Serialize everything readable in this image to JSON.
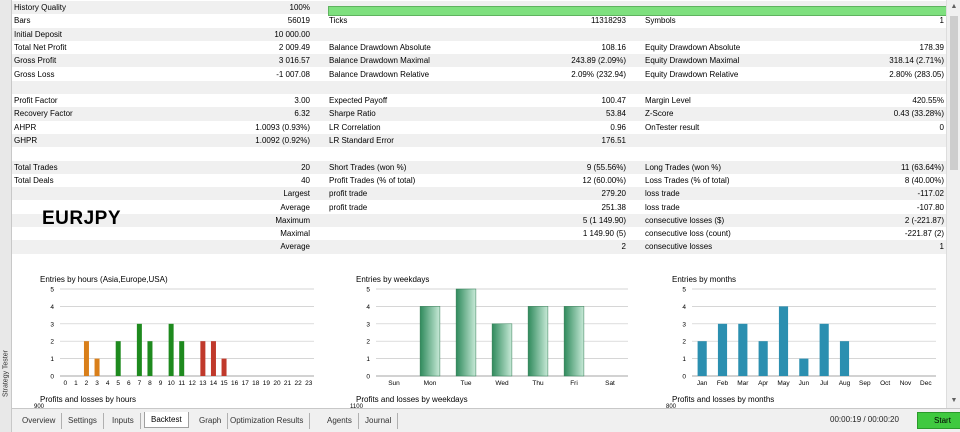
{
  "sidebar": {
    "label": "Strategy Tester"
  },
  "symbol": "EURJPY",
  "rows": [
    {
      "alt": true,
      "c": [
        [
          "History Quality",
          "100%"
        ],
        null,
        null
      ]
    },
    {
      "alt": false,
      "c": [
        [
          "Bars",
          "56019"
        ],
        [
          "Ticks",
          "11318293"
        ],
        [
          "Symbols",
          "1"
        ]
      ]
    },
    {
      "alt": true,
      "c": [
        [
          "Initial Deposit",
          "10 000.00"
        ],
        null,
        null
      ]
    },
    {
      "alt": false,
      "c": [
        [
          "Total Net Profit",
          "2 009.49"
        ],
        [
          "Balance Drawdown Absolute",
          "108.16"
        ],
        [
          "Equity Drawdown Absolute",
          "178.39"
        ]
      ]
    },
    {
      "alt": true,
      "c": [
        [
          "Gross Profit",
          "3 016.57"
        ],
        [
          "Balance Drawdown Maximal",
          "243.89 (2.09%)"
        ],
        [
          "Equity Drawdown Maximal",
          "318.14 (2.71%)"
        ]
      ]
    },
    {
      "alt": false,
      "c": [
        [
          "Gross Loss",
          "-1 007.08"
        ],
        [
          "Balance Drawdown Relative",
          "2.09% (232.94)"
        ],
        [
          "Equity Drawdown Relative",
          "2.80% (283.05)"
        ]
      ]
    },
    {
      "alt": true,
      "c": [
        null,
        null,
        null
      ]
    },
    {
      "alt": false,
      "c": [
        [
          "Profit Factor",
          "3.00"
        ],
        [
          "Expected Payoff",
          "100.47"
        ],
        [
          "Margin Level",
          "420.55%"
        ]
      ]
    },
    {
      "alt": true,
      "c": [
        [
          "Recovery Factor",
          "6.32"
        ],
        [
          "Sharpe Ratio",
          "53.84"
        ],
        [
          "Z-Score",
          "0.43 (33.28%)"
        ]
      ]
    },
    {
      "alt": false,
      "c": [
        [
          "AHPR",
          "1.0093 (0.93%)"
        ],
        [
          "LR Correlation",
          "0.96"
        ],
        [
          "OnTester result",
          "0"
        ]
      ]
    },
    {
      "alt": true,
      "c": [
        [
          "GHPR",
          "1.0092 (0.92%)"
        ],
        [
          "LR Standard Error",
          "176.51"
        ],
        null
      ]
    },
    {
      "alt": false,
      "c": [
        null,
        null,
        null
      ]
    },
    {
      "alt": true,
      "c": [
        [
          "Total Trades",
          "20"
        ],
        [
          "Short Trades (won %)",
          "9 (55.56%)"
        ],
        [
          "Long Trades (won %)",
          "11 (63.64%)"
        ]
      ]
    },
    {
      "alt": false,
      "c": [
        [
          "Total Deals",
          "40"
        ],
        [
          "Profit Trades (% of total)",
          "12 (60.00%)"
        ],
        [
          "Loss Trades (% of total)",
          "8 (40.00%)"
        ]
      ]
    },
    {
      "alt": true,
      "c": [
        [
          "Largest",
          "",
          "r"
        ],
        [
          "profit trade",
          "279.20"
        ],
        [
          "loss trade",
          "-117.02"
        ]
      ]
    },
    {
      "alt": false,
      "c": [
        [
          "Average",
          "",
          "r"
        ],
        [
          "profit trade",
          "251.38"
        ],
        [
          "loss trade",
          "-107.80"
        ]
      ]
    },
    {
      "alt": true,
      "c": [
        [
          "Maximum",
          "",
          "r"
        ],
        [
          "",
          "5 (1 149.90)"
        ],
        [
          "consecutive losses ($)",
          "2 (-221.87)"
        ]
      ]
    },
    {
      "alt": false,
      "c": [
        [
          "Maximal",
          "",
          "r"
        ],
        [
          "",
          "1 149.90 (5)"
        ],
        [
          "consecutive loss (count)",
          "-221.87 (2)"
        ]
      ]
    },
    {
      "alt": true,
      "c": [
        [
          "Average",
          "",
          "r"
        ],
        [
          "",
          "2"
        ],
        [
          "consecutive losses",
          "1"
        ]
      ]
    }
  ],
  "charts": [
    {
      "type": "bar",
      "title": "Entries by hours (Asia,Europe,USA)",
      "categories": [
        "0",
        "1",
        "2",
        "3",
        "4",
        "5",
        "6",
        "7",
        "8",
        "9",
        "10",
        "11",
        "12",
        "13",
        "14",
        "15",
        "16",
        "17",
        "18",
        "19",
        "20",
        "21",
        "22",
        "23"
      ],
      "values": [
        0,
        0,
        2,
        1,
        0,
        2,
        0,
        3,
        2,
        0,
        3,
        2,
        0,
        2,
        2,
        1,
        0,
        0,
        0,
        0,
        0,
        0,
        0,
        0
      ],
      "bar_colors": [
        "#d97f1a",
        "#d97f1a",
        "#d97f1a",
        "#d97f1a",
        "#d97f1a",
        "#1e8a1e",
        "#1e8a1e",
        "#1e8a1e",
        "#1e8a1e",
        "#1e8a1e",
        "#1e8a1e",
        "#1e8a1e",
        "#1e8a1e",
        "#c0392b",
        "#c0392b",
        "#c0392b",
        "#c0392b",
        "#c0392b",
        "#c0392b",
        "#c0392b",
        "#c0392b",
        "#c0392b",
        "#c0392b",
        "#c0392b"
      ],
      "ylim": [
        0,
        5
      ],
      "yticks": [
        "0",
        "1",
        "2",
        "3",
        "4",
        "5"
      ],
      "style": "thin",
      "bottom_title": "Profits and losses by hours",
      "bottom_tick": "900"
    },
    {
      "type": "bar",
      "title": "Entries by weekdays",
      "categories": [
        "Sun",
        "Mon",
        "Tue",
        "Wed",
        "Thu",
        "Fri",
        "Sat"
      ],
      "values": [
        0,
        4,
        5,
        3,
        4,
        4,
        0
      ],
      "bar_colors": [
        "#3a9a6a",
        "#3a9a6a",
        "#3a9a6a",
        "#3a9a6a",
        "#3a9a6a",
        "#3a9a6a",
        "#3a9a6a"
      ],
      "ylim": [
        0,
        5
      ],
      "yticks": [
        "0",
        "1",
        "2",
        "3",
        "4",
        "5"
      ],
      "style": "wide",
      "bottom_title": "Profits and losses by weekdays",
      "bottom_tick": "1100"
    },
    {
      "type": "bar",
      "title": "Entries by months",
      "categories": [
        "Jan",
        "Feb",
        "Mar",
        "Apr",
        "May",
        "Jun",
        "Jul",
        "Aug",
        "Sep",
        "Oct",
        "Nov",
        "Dec"
      ],
      "values": [
        2,
        3,
        3,
        2,
        4,
        1,
        3,
        2,
        0,
        0,
        0,
        0
      ],
      "bar_colors": [
        "#2b8fb0",
        "#2b8fb0",
        "#2b8fb0",
        "#2b8fb0",
        "#2b8fb0",
        "#2b8fb0",
        "#2b8fb0",
        "#2b8fb0",
        "#2b8fb0",
        "#2b8fb0",
        "#2b8fb0",
        "#2b8fb0"
      ],
      "ylim": [
        0,
        5
      ],
      "yticks": [
        "0",
        "1",
        "2",
        "3",
        "4",
        "5"
      ],
      "style": "medium",
      "bottom_title": "Profits and losses by months",
      "bottom_tick": "800"
    }
  ],
  "chart_data": [
    {
      "type": "bar",
      "title": "Entries by hours (Asia,Europe,USA)",
      "categories": [
        "0",
        "1",
        "2",
        "3",
        "4",
        "5",
        "6",
        "7",
        "8",
        "9",
        "10",
        "11",
        "12",
        "13",
        "14",
        "15",
        "16",
        "17",
        "18",
        "19",
        "20",
        "21",
        "22",
        "23"
      ],
      "values": [
        0,
        0,
        2,
        1,
        0,
        2,
        0,
        3,
        2,
        0,
        3,
        2,
        0,
        2,
        2,
        1,
        0,
        0,
        0,
        0,
        0,
        0,
        0,
        0
      ],
      "ylim": [
        0,
        5
      ]
    },
    {
      "type": "bar",
      "title": "Entries by weekdays",
      "categories": [
        "Sun",
        "Mon",
        "Tue",
        "Wed",
        "Thu",
        "Fri",
        "Sat"
      ],
      "values": [
        0,
        4,
        5,
        3,
        4,
        4,
        0
      ],
      "ylim": [
        0,
        5
      ]
    },
    {
      "type": "bar",
      "title": "Entries by months",
      "categories": [
        "Jan",
        "Feb",
        "Mar",
        "Apr",
        "May",
        "Jun",
        "Jul",
        "Aug",
        "Sep",
        "Oct",
        "Nov",
        "Dec"
      ],
      "values": [
        2,
        3,
        3,
        2,
        4,
        1,
        3,
        2,
        0,
        0,
        0,
        0
      ],
      "ylim": [
        0,
        5
      ]
    }
  ],
  "tabs": [
    "Overview",
    "Settings",
    "Inputs",
    "Backtest",
    "Graph",
    "Optimization Results",
    "Agents",
    "Journal"
  ],
  "active_tab": "Backtest",
  "timer": "00:00:19 / 00:00:20",
  "start_label": "Start",
  "history_quality_fraction": 1.0
}
